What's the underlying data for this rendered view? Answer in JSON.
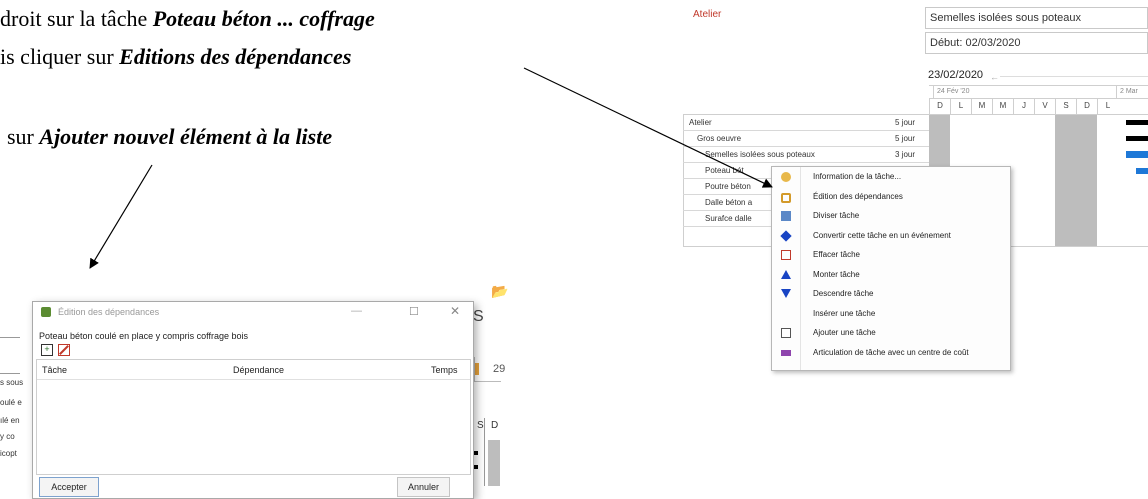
{
  "instructions": {
    "line1_prefix": "droit sur la tâche",
    "line1_bold": "Poteau béton ... coffrage",
    "line2_prefix": "is cliquer sur",
    "line2_bold": "Editions des dépendances",
    "line3_prefix": "sur",
    "line3_bold": "Ajouter nouvel élément à la liste"
  },
  "gantt": {
    "group_label": "Atelier",
    "task_name_box": "Semelles isolées sous poteaux",
    "start_box": "Début: 02/03/2020",
    "timeline_date": "23/02/2020",
    "week_labels": [
      "24 Fév '20",
      "2 Mar"
    ],
    "day_letters": [
      "D",
      "L",
      "M",
      "M",
      "J",
      "V",
      "S",
      "D",
      "L"
    ],
    "tasks": [
      {
        "name": "Atelier",
        "duration": "5 jour"
      },
      {
        "name": "Gros oeuvre",
        "duration": "5 jour"
      },
      {
        "name": "Semelles isolées sous poteaux",
        "duration": "3 jour"
      },
      {
        "name": "Poteau bét",
        "duration": ""
      },
      {
        "name": "Poutre béton",
        "duration": ""
      },
      {
        "name": "Dalle béton a",
        "duration": ""
      },
      {
        "name": "Surafce dalle",
        "duration": ""
      }
    ]
  },
  "context_menu": {
    "items": [
      {
        "label": "Information de la tâche...",
        "icon": "info-icon"
      },
      {
        "label": "Édition des dépendances",
        "icon": "dependencies-icon"
      },
      {
        "label": "Diviser tâche",
        "icon": "split-icon"
      },
      {
        "label": "Convertir cette tâche en un événement",
        "icon": "diamond-icon"
      },
      {
        "label": "Effacer tâche",
        "icon": "delete-icon"
      },
      {
        "label": "Monter tâche",
        "icon": "arrow-up-icon"
      },
      {
        "label": "Descendre tâche",
        "icon": "arrow-down-icon"
      },
      {
        "label": "Insérer une tâche",
        "icon": ""
      },
      {
        "label": "Ajouter une tâche",
        "icon": "add-icon"
      },
      {
        "label": "Articulation de tâche avec un centre de coût",
        "icon": "cost-center-icon"
      }
    ]
  },
  "dialog": {
    "title": "Édition des dépendances",
    "subtitle": "Poteau béton coulé en place y compris coffrage bois",
    "columns": [
      "Tâche",
      "Dépendance",
      "Temps"
    ],
    "accept_label": "Accepter",
    "cancel_label": "Annuler"
  },
  "background_fragments": {
    "header_s": "S",
    "date_29": "29",
    "day_s": "S",
    "day_d": "D",
    "rows": [
      "s sous",
      "oulé e",
      "ılé en",
      "y co",
      "icopt"
    ]
  }
}
